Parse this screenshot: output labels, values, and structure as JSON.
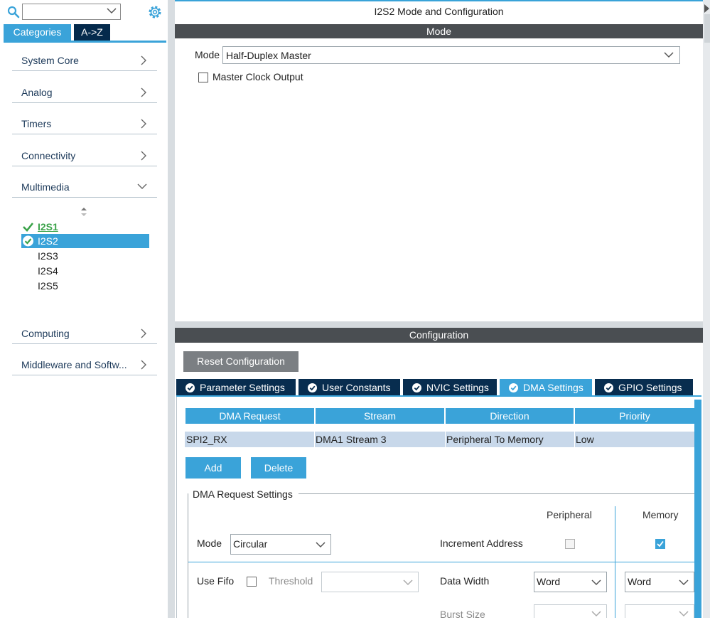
{
  "left": {
    "search_placeholder": "",
    "tabs": {
      "categories": "Categories",
      "az": "A->Z"
    },
    "categories": [
      {
        "label": "System Core"
      },
      {
        "label": "Analog"
      },
      {
        "label": "Timers"
      },
      {
        "label": "Connectivity"
      },
      {
        "label": "Multimedia"
      },
      {
        "label": "Computing"
      },
      {
        "label": "Middleware and Softw..."
      }
    ],
    "multimedia_items": [
      {
        "label": "I2S1",
        "state": "enabled"
      },
      {
        "label": "I2S2",
        "state": "selected"
      },
      {
        "label": "I2S3",
        "state": "none"
      },
      {
        "label": "I2S4",
        "state": "none"
      },
      {
        "label": "I2S5",
        "state": "none"
      }
    ]
  },
  "right": {
    "title": "I2S2 Mode and Configuration",
    "mode_section": "Mode",
    "mode_label": "Mode",
    "mode_value": "Half-Duplex Master",
    "master_clock_output": "Master Clock Output",
    "config_section": "Configuration",
    "reset_button": "Reset Configuration",
    "tabs": [
      {
        "label": "Parameter Settings",
        "active": false
      },
      {
        "label": "User Constants",
        "active": false
      },
      {
        "label": "NVIC Settings",
        "active": false
      },
      {
        "label": "DMA Settings",
        "active": true
      },
      {
        "label": "GPIO Settings",
        "active": false
      }
    ],
    "dma_table": {
      "headers": [
        "DMA Request",
        "Stream",
        "Direction",
        "Priority"
      ],
      "rows": [
        [
          "SPI2_RX",
          "DMA1 Stream 3",
          "Peripheral To Memory",
          "Low"
        ]
      ]
    },
    "add_button": "Add",
    "delete_button": "Delete",
    "dma_request_settings": {
      "title": "DMA Request Settings",
      "peripheral_header": "Peripheral",
      "memory_header": "Memory",
      "mode_label": "Mode",
      "mode_value": "Circular",
      "increment_address_label": "Increment Address",
      "peripheral_increment": false,
      "memory_increment": true,
      "use_fifo_label": "Use Fifo",
      "use_fifo": false,
      "threshold_label": "Threshold",
      "threshold_value": "",
      "data_width_label": "Data Width",
      "peripheral_data_width": "Word",
      "memory_data_width": "Word",
      "burst_size_label": "Burst Size"
    }
  },
  "colors": {
    "accent": "#3aa3d9",
    "dark_navy": "#082d4f",
    "section_bar": "#4a4e52",
    "enabled_green": "#3ba34a",
    "row_bg": "#c8d8ea"
  }
}
